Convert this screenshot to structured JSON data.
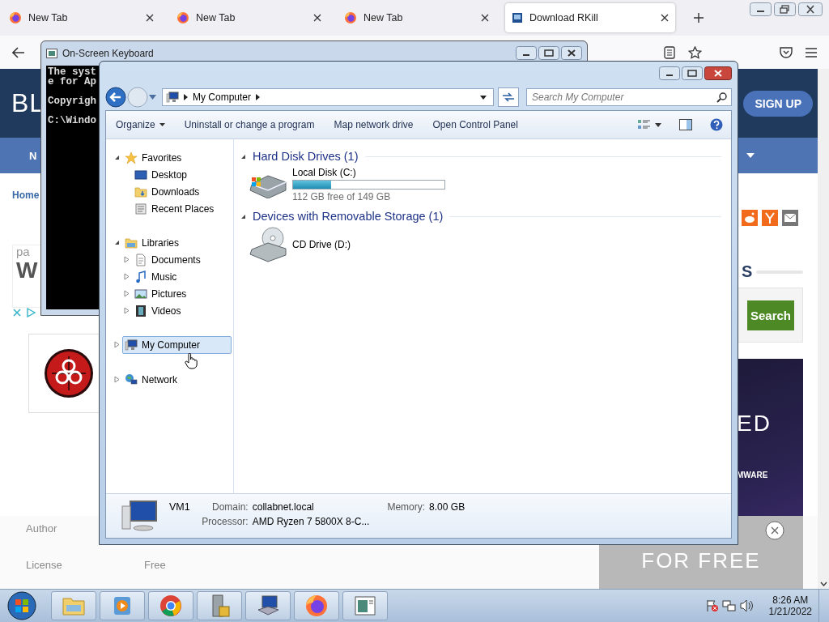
{
  "browser": {
    "tabs": [
      {
        "title": "New Tab",
        "kind": "firefox",
        "selected": false
      },
      {
        "title": "New Tab",
        "kind": "firefox",
        "selected": false
      },
      {
        "title": "New Tab",
        "kind": "firefox",
        "selected": false
      },
      {
        "title": "Download RKill",
        "kind": "site",
        "selected": true
      }
    ]
  },
  "page": {
    "logo": "BL",
    "signup": "SIGN UP",
    "nav_item": "N",
    "breadcrumb": "Home",
    "ad_small": "pa",
    "ad_big": "W",
    "sidebar_heading": "S",
    "search_button": "Search",
    "banner_big": "ED",
    "banner_small": "MWARE",
    "footer_rows": [
      {
        "label": "Author",
        "value": ""
      },
      {
        "label": "License",
        "value": "Free"
      }
    ],
    "footer_ad": "FOR FREE"
  },
  "keyboard_window": {
    "title": "On-Screen Keyboard",
    "paragraphs": [
      [
        "The syst",
        "e for Ap"
      ],
      [
        "Copyrigh"
      ],
      [
        "C:\\Windo"
      ]
    ]
  },
  "explorer": {
    "breadcrumb": "My Computer",
    "search_placeholder": "Search My Computer",
    "commands": [
      {
        "label": "Organize",
        "kind": "menu"
      },
      {
        "label": "Uninstall or change a program",
        "kind": "plain"
      },
      {
        "label": "Map network drive",
        "kind": "plain"
      },
      {
        "label": "Open Control Panel",
        "kind": "plain"
      }
    ],
    "nav": [
      {
        "label": "Favorites",
        "kind": "favorites",
        "expanded": true,
        "selected": false,
        "children": [
          {
            "label": "Desktop",
            "kind": "desktop",
            "selected": false
          },
          {
            "label": "Downloads",
            "kind": "downloads",
            "selected": false
          },
          {
            "label": "Recent Places",
            "kind": "recent",
            "selected": false
          }
        ]
      },
      {
        "label": "Libraries",
        "kind": "libraries",
        "expanded": true,
        "selected": false,
        "children": [
          {
            "label": "Documents",
            "kind": "documents",
            "expanded": false,
            "selected": false
          },
          {
            "label": "Music",
            "kind": "music",
            "expanded": false,
            "selected": false
          },
          {
            "label": "Pictures",
            "kind": "pictures",
            "expanded": false,
            "selected": false
          },
          {
            "label": "Videos",
            "kind": "videos",
            "expanded": false,
            "selected": false
          }
        ]
      },
      {
        "label": "My Computer",
        "kind": "computer",
        "expanded": false,
        "selected": true
      },
      {
        "label": "Network",
        "kind": "network",
        "expanded": false,
        "selected": false
      }
    ],
    "sections": [
      {
        "title": "Hard Disk Drives (1)",
        "expanded": true,
        "items": [
          {
            "name": "Local Disk (C:)",
            "kind": "disk",
            "level": 0.25,
            "info": "112 GB free of 149 GB"
          }
        ]
      },
      {
        "title": "Devices with Removable Storage (1)",
        "expanded": true,
        "items": [
          {
            "name": "CD Drive (D:)",
            "kind": "cd"
          }
        ]
      }
    ],
    "details": {
      "name": "VM1",
      "fields": [
        {
          "label": "Domain:",
          "value": "collabnet.local"
        },
        {
          "label": "Memory:",
          "value": "8.00 GB"
        },
        {
          "label": "Processor:",
          "value": "AMD Ryzen 7 5800X 8-C..."
        }
      ]
    }
  },
  "taskbar": {
    "apps": [
      {
        "kind": "explorer"
      },
      {
        "kind": "media"
      },
      {
        "kind": "chrome"
      },
      {
        "kind": "server"
      },
      {
        "kind": "computer"
      },
      {
        "kind": "firefox"
      },
      {
        "kind": "window"
      }
    ],
    "time": "8:26 AM",
    "date": "1/21/2022"
  }
}
